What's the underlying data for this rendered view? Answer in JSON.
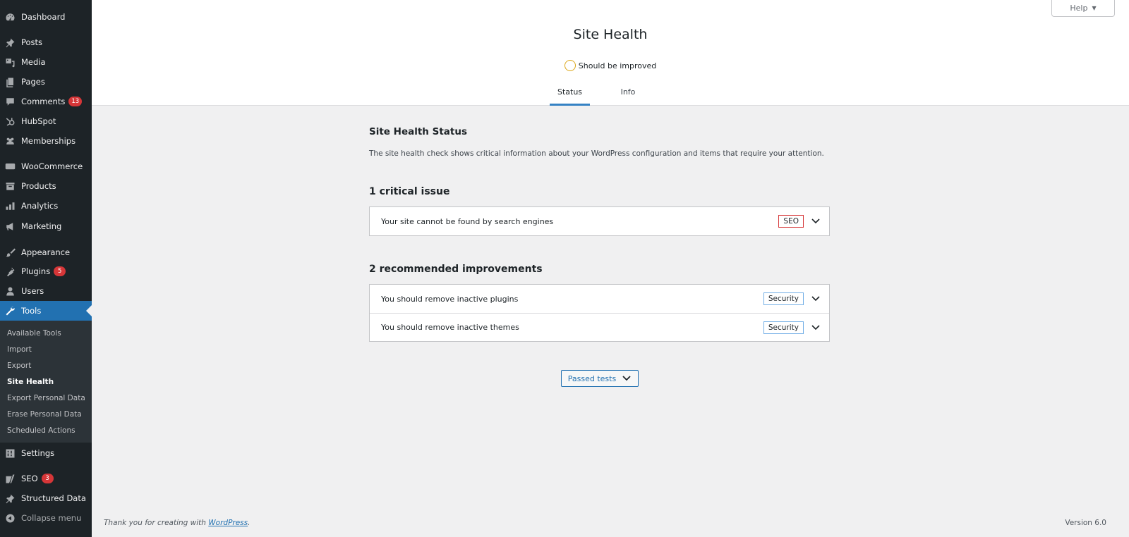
{
  "sidebar": {
    "items": [
      {
        "label": "Dashboard",
        "icon": "dashboard-icon"
      },
      {
        "label": "Posts",
        "icon": "pin-icon"
      },
      {
        "label": "Media",
        "icon": "media-icon"
      },
      {
        "label": "Pages",
        "icon": "pages-icon"
      },
      {
        "label": "Comments",
        "icon": "comment-icon",
        "badge": "13"
      },
      {
        "label": "HubSpot",
        "icon": "hubspot-icon"
      },
      {
        "label": "Memberships",
        "icon": "groups-icon"
      },
      {
        "label": "WooCommerce",
        "icon": "woocommerce-icon"
      },
      {
        "label": "Products",
        "icon": "archive-icon"
      },
      {
        "label": "Analytics",
        "icon": "bar-chart-icon"
      },
      {
        "label": "Marketing",
        "icon": "megaphone-icon"
      },
      {
        "label": "Appearance",
        "icon": "paintbrush-icon"
      },
      {
        "label": "Plugins",
        "icon": "plugin-icon",
        "badge": "5"
      },
      {
        "label": "Users",
        "icon": "user-icon"
      },
      {
        "label": "Tools",
        "icon": "wrench-icon",
        "active": true
      },
      {
        "label": "Settings",
        "icon": "settings-icon"
      },
      {
        "label": "SEO",
        "icon": "yoast-icon",
        "badge": "3"
      },
      {
        "label": "Structured Data",
        "icon": "pin-icon"
      },
      {
        "label": "Collapse menu",
        "icon": "collapse-icon"
      }
    ],
    "submenu": [
      {
        "label": "Available Tools"
      },
      {
        "label": "Import"
      },
      {
        "label": "Export"
      },
      {
        "label": "Site Health",
        "current": true
      },
      {
        "label": "Export Personal Data"
      },
      {
        "label": "Erase Personal Data"
      },
      {
        "label": "Scheduled Actions"
      }
    ]
  },
  "header": {
    "help_label": "Help",
    "title": "Site Health",
    "status": "Should be improved",
    "tabs": [
      {
        "label": "Status",
        "active": true
      },
      {
        "label": "Info"
      }
    ]
  },
  "main": {
    "title": "Site Health Status",
    "description": "The site health check shows critical information about your WordPress configuration and items that require your attention.",
    "critical_heading": "1 critical issue",
    "critical_issues": [
      {
        "label": "Your site cannot be found by search engines",
        "tag": "SEO"
      }
    ],
    "recommended_heading": "2 recommended improvements",
    "recommended": [
      {
        "label": "You should remove inactive plugins",
        "tag": "Security"
      },
      {
        "label": "You should remove inactive themes",
        "tag": "Security"
      }
    ],
    "passed_tests_label": "Passed tests"
  },
  "footer": {
    "thanks_prefix": "Thank you for creating with ",
    "thanks_link": "WordPress",
    "thanks_suffix": ".",
    "version": "Version 6.0"
  },
  "colors": {
    "accent": "#2271b1",
    "sidebar_bg": "#1d2327",
    "badge": "#d63638",
    "status_ring": "#dba617"
  }
}
